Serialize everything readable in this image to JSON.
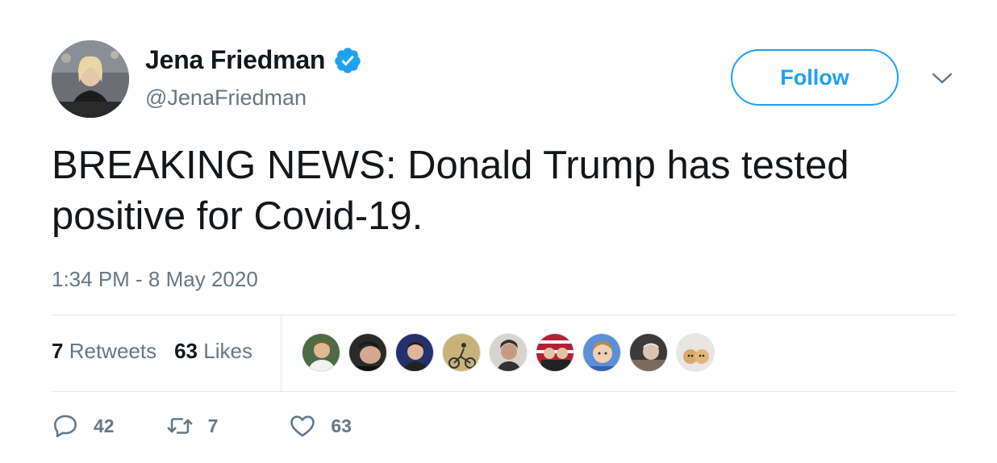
{
  "user": {
    "name": "Jena Friedman",
    "handle": "@JenaFriedman",
    "verified": true
  },
  "follow_button_label": "Follow",
  "tweet": {
    "text": "BREAKING NEWS: Donald Trump has tested positive for Covid-19.",
    "timestamp": "1:34 PM - 8 May 2020"
  },
  "stats": {
    "retweets_count": "7",
    "retweets_label": "Retweets",
    "likes_count": "63",
    "likes_label": "Likes"
  },
  "actions": {
    "replies": "42",
    "retweets": "7",
    "likes": "63"
  },
  "colors": {
    "accent": "#1da1f2",
    "muted_text": "#657786",
    "text": "#14171a",
    "divider": "#e1e8ed"
  },
  "icons": {
    "verified": "verified-badge-icon",
    "more": "chevron-down-icon",
    "reply": "reply-icon",
    "retweet": "retweet-icon",
    "like": "heart-icon"
  }
}
